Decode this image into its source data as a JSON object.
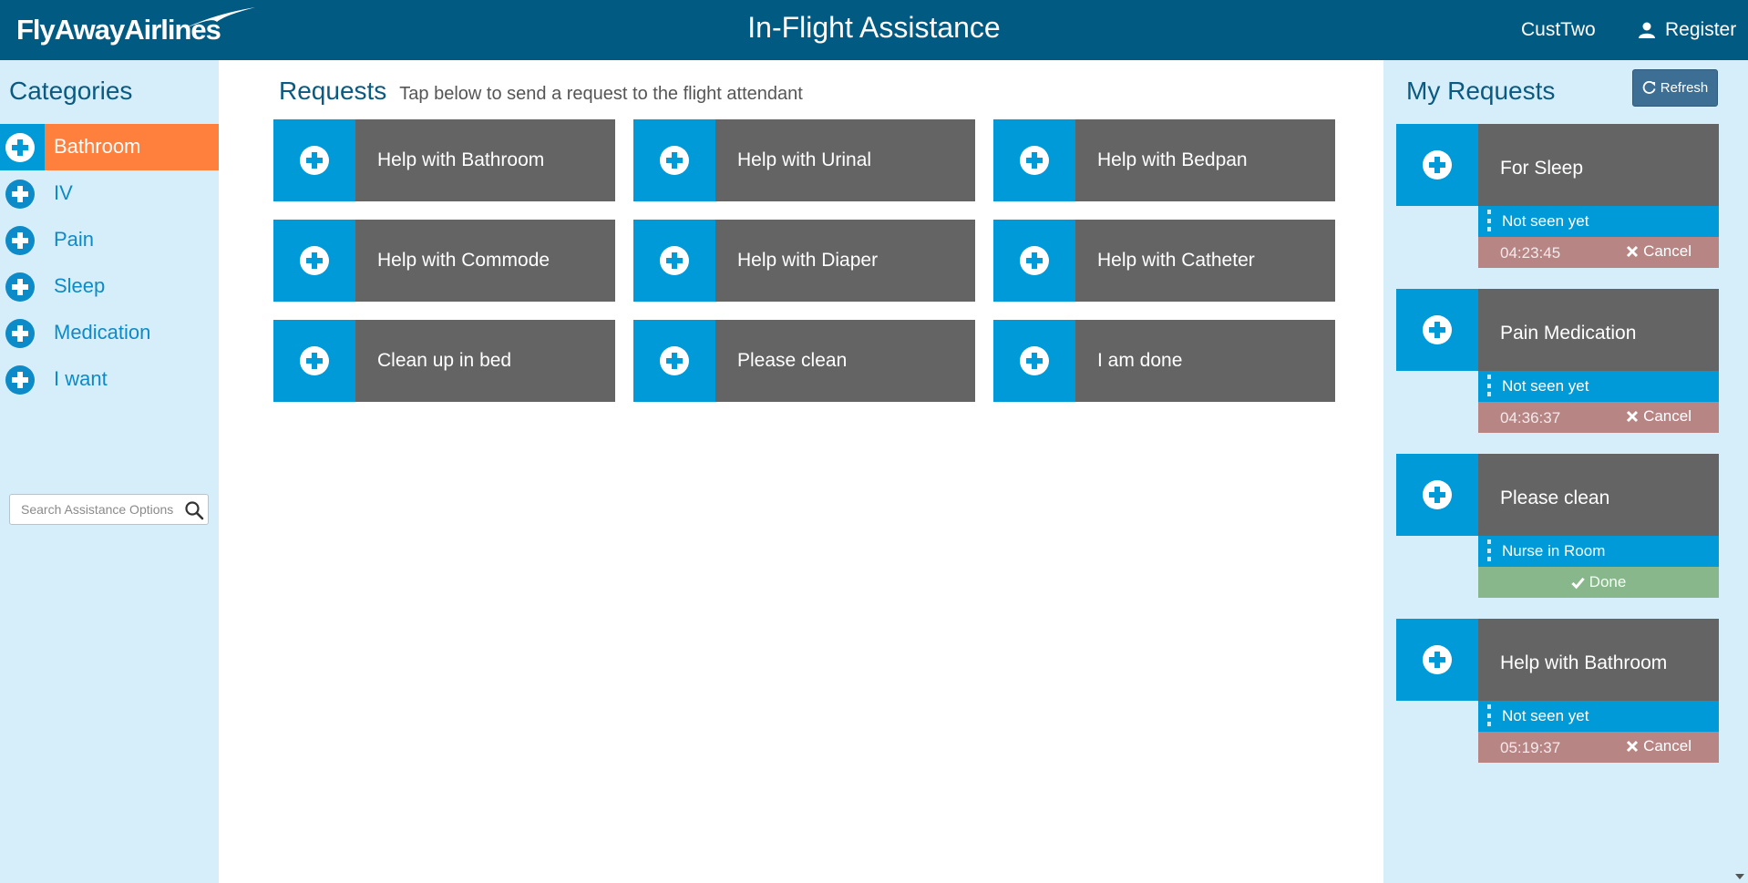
{
  "header": {
    "logo_text": "FlyAwayAirlines",
    "title": "In-Flight Assistance",
    "user_name": "CustTwo",
    "register_label": "Register",
    "colors": {
      "background": "#005a82",
      "text": "#ffffff"
    }
  },
  "sidebar": {
    "title": "Categories",
    "items": [
      {
        "label": "Bathroom",
        "active": true,
        "icon": "plus-circle-icon"
      },
      {
        "label": "IV",
        "active": false,
        "icon": "plus-circle-icon"
      },
      {
        "label": "Pain",
        "active": false,
        "icon": "plus-circle-icon"
      },
      {
        "label": "Sleep",
        "active": false,
        "icon": "plus-circle-icon"
      },
      {
        "label": "Medication",
        "active": false,
        "icon": "plus-circle-icon"
      },
      {
        "label": "I want",
        "active": false,
        "icon": "plus-circle-icon"
      }
    ],
    "search": {
      "placeholder": "Search Assistance Options",
      "value": "",
      "icon": "search-icon"
    },
    "colors": {
      "background": "#d6eef9",
      "active": "#ff7f3c",
      "icon_bg": "#009ad9",
      "label": "#0d8ac8"
    }
  },
  "main": {
    "title": "Requests",
    "subtitle": "Tap below to send a request to the flight attendant",
    "tiles": [
      {
        "label": "Help with Bathroom"
      },
      {
        "label": "Help with Urinal"
      },
      {
        "label": "Help with Bedpan"
      },
      {
        "label": "Help with Commode"
      },
      {
        "label": "Help with Diaper"
      },
      {
        "label": "Help with Catheter"
      },
      {
        "label": "Clean up in bed"
      },
      {
        "label": "Please clean"
      },
      {
        "label": "I am done"
      }
    ],
    "colors": {
      "icon_bg": "#009ad9",
      "label_bg": "#646464"
    }
  },
  "my_requests": {
    "title": "My Requests",
    "refresh_label": "Refresh",
    "items": [
      {
        "label": "For Sleep",
        "status": "Not seen yet",
        "time": "04:23:45",
        "action": "Cancel",
        "action_type": "cancel"
      },
      {
        "label": "Pain Medication",
        "status": "Not seen yet",
        "time": "04:36:37",
        "action": "Cancel",
        "action_type": "cancel"
      },
      {
        "label": "Please clean",
        "status": "Nurse in Room",
        "time": "",
        "action": "Done",
        "action_type": "done"
      },
      {
        "label": "Help with Bathroom",
        "status": "Not seen yet",
        "time": "05:19:37",
        "action": "Cancel",
        "action_type": "cancel"
      }
    ],
    "colors": {
      "cancel_bg": "#b88585",
      "done_bg": "#88b78c",
      "status_bg": "#009ad9"
    }
  }
}
